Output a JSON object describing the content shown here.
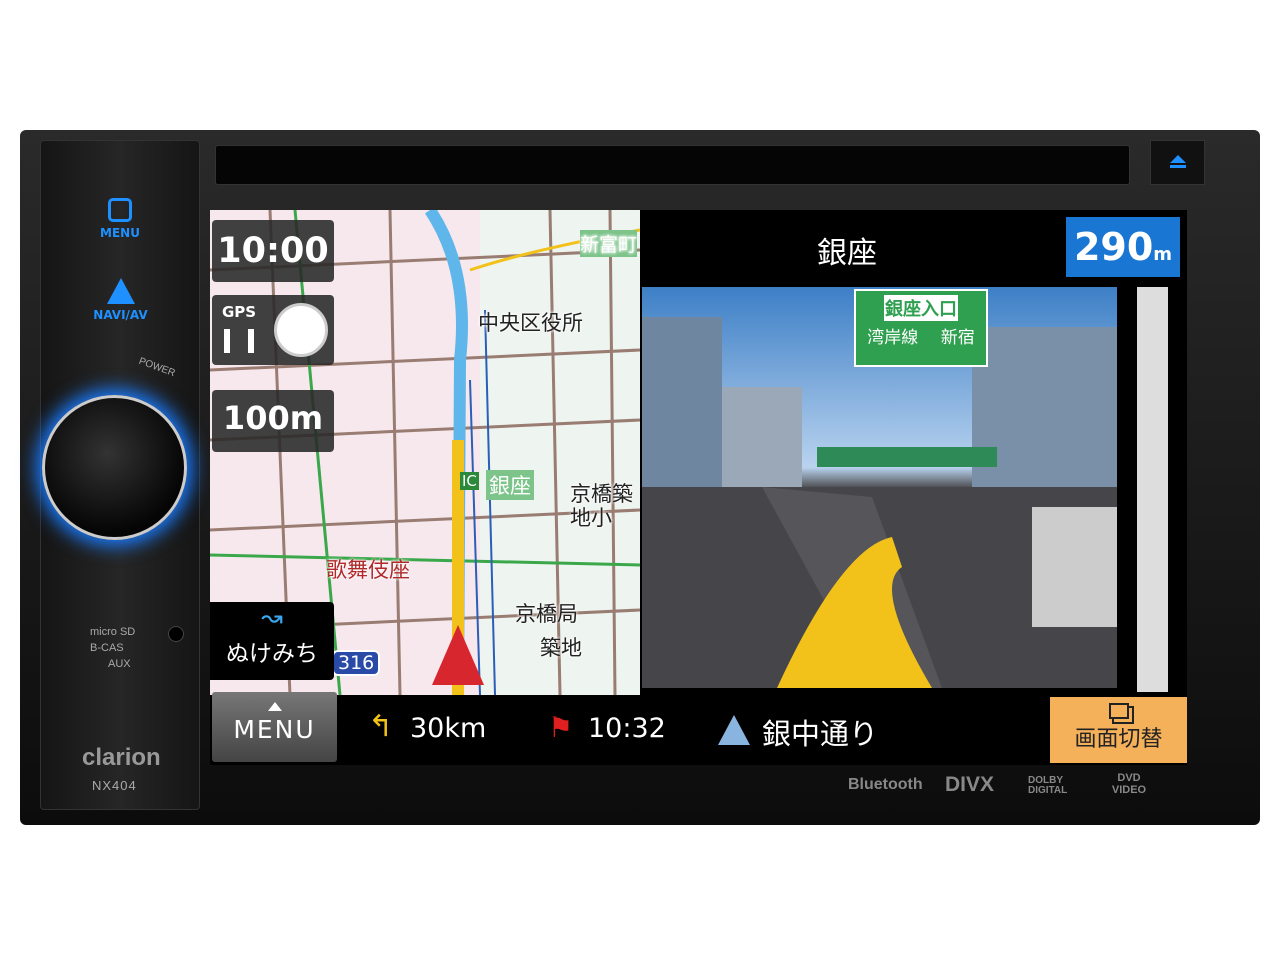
{
  "device": {
    "brand": "clarion",
    "model": "NX404",
    "power_label": "POWER",
    "buttons": {
      "menu": "MENU",
      "navi_av": "NAVI/AV"
    },
    "slots": [
      "micro SD",
      "B-CAS",
      "AUX"
    ],
    "logos": [
      "Bluetooth",
      "DIVX",
      "DOLBY DIGITAL",
      "DVD VIDEO"
    ]
  },
  "map": {
    "time": "10:00",
    "gps_label": "GPS",
    "scale": "100m",
    "bypass_label": "ぬけみち",
    "route_number": "316",
    "labels": {
      "city_office": "中央区役所",
      "shintomicho": "新富町",
      "ic": "IC",
      "ginza": "銀座",
      "kyobashi_school": "京橋築地小",
      "kabukiza": "歌舞伎座",
      "post_office": "京橋局",
      "tsukiji": "築地"
    }
  },
  "guide": {
    "place": "銀座",
    "distance_value": "290",
    "distance_unit": "m",
    "sign": {
      "title": "銀座入口",
      "left": "湾岸線",
      "right": "新宿"
    }
  },
  "bottom": {
    "menu_label": "MENU",
    "remaining_distance": "30km",
    "arrival_time": "10:32",
    "road_name": "銀中通り",
    "switch_label": "画面切替"
  },
  "colors": {
    "accent_blue": "#1976d2",
    "switch_button": "#f5b05a",
    "knob_glow": "#1a7cff"
  }
}
